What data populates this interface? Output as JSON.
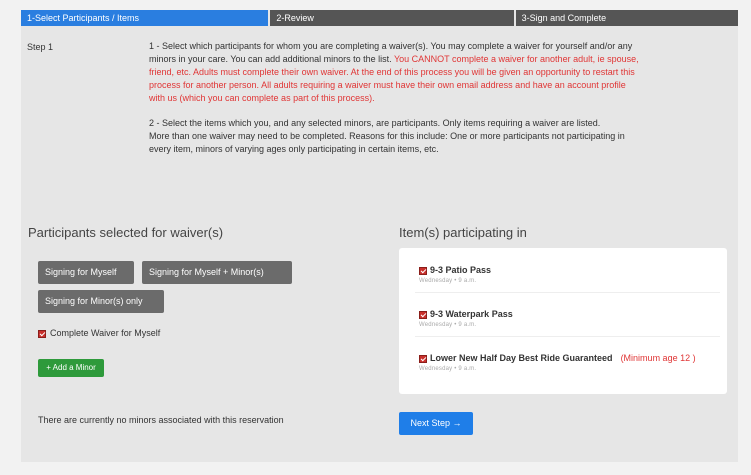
{
  "tabs": [
    {
      "label": "1-Select Participants / Items"
    },
    {
      "label": "2-Review"
    },
    {
      "label": "3-Sign and Complete"
    }
  ],
  "step": {
    "label": "Step 1"
  },
  "instructions": {
    "p1_normal": "1 - Select which participants for whom you are completing a waiver(s). You may complete a waiver for yourself and/or any minors in your care. You can add additional minors to the list. ",
    "p1_red": "You CANNOT complete a waiver for another adult, ie spouse, friend, etc. Adults must complete their own waiver. At the end of this process you will be given an opportunity to restart this process for another person. All adults requiring a waiver must have their own email address and have an account profile with us (which you can complete as part of this process).",
    "p2_line1": "2 - Select the items which you, and any selected minors, are participants. Only items requiring a waiver are listed.",
    "p2_line2": "More than one waiver may need to be completed. Reasons for this include: One or more participants not participating in every item, minors of varying ages only participating in certain items, etc."
  },
  "participants": {
    "title": "Participants selected for waiver(s)",
    "btn_myself": "Signing for Myself",
    "btn_myself_minor": "Signing for Myself + Minor(s)",
    "btn_minor_only": "Signing for Minor(s) only",
    "complete_label": "Complete Waiver for Myself",
    "add_minor": "+ Add a Minor",
    "no_minors": "There are currently no minors associated with this reservation"
  },
  "items": {
    "title": "Item(s) participating in",
    "list": [
      {
        "name": "9-3 Patio Pass",
        "sub": "Wednesday • 9 a.m.",
        "min_age": ""
      },
      {
        "name": "9-3 Waterpark Pass",
        "sub": "Wednesday • 9 a.m.",
        "min_age": ""
      },
      {
        "name": "Lower New Half Day Best Ride Guaranteed",
        "sub": "Wednesday • 9 a.m.",
        "min_age": "(Minimum age 12 )"
      }
    ]
  },
  "next_step": "Next Step →",
  "colors": {
    "active_tab": "#2a7ee0",
    "inactive_tab": "#555555",
    "warning_red": "#e03535",
    "add_green": "#2e9a3b",
    "next_blue": "#1f7ee8"
  }
}
